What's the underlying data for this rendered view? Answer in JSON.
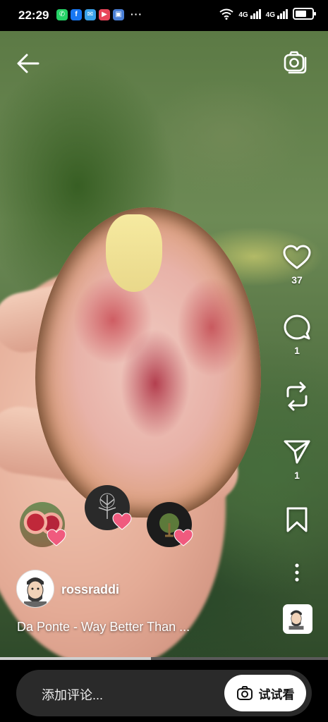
{
  "status_bar": {
    "time": "22:29",
    "more": "···",
    "network_1": "4G",
    "network_2": "4G"
  },
  "header": {
    "back_icon": "arrow-left-icon",
    "camera_icon": "camera-icon"
  },
  "actions": {
    "likes": "37",
    "comments": "1",
    "remixes": "",
    "shares": "1"
  },
  "post": {
    "username": "rossraddi",
    "caption": "Da Ponte - Way Better Than ..."
  },
  "progress": {
    "fraction": 0.46
  },
  "comment_bar": {
    "placeholder": "添加评论...",
    "try_label": "试试看"
  },
  "colors": {
    "heart": "#f05a7e",
    "overlay_text": "#ffffff",
    "pill_bg": "#2a2a2a"
  }
}
